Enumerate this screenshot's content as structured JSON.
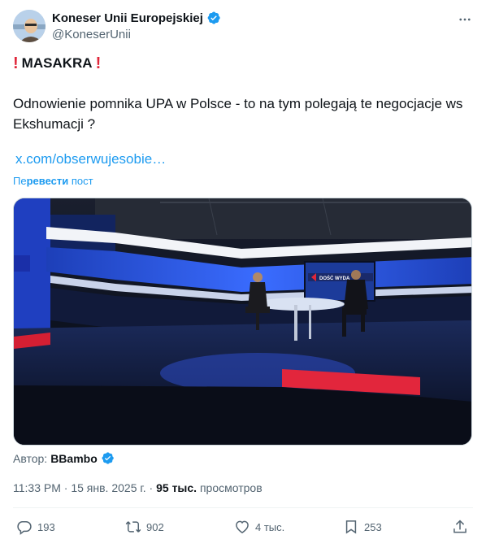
{
  "header": {
    "display_name": "Koneser Unii Europejskiej",
    "handle": "@KoneserUnii",
    "more_icon": "more-horizontal-icon",
    "verified_color": "#1d9bf0"
  },
  "post": {
    "headline": "MASAKRA",
    "body": "Odnowienie pomnika UPA w Polsce - to na tym polegają te negocjacje ws Ekshumacji ?",
    "link": "x.com/obserwujesobie…",
    "translate_prefix": "Пе",
    "translate_bold": "ревести",
    "translate_suffix": " пост"
  },
  "media": {
    "screen_text": "DOŚĆ WYDA"
  },
  "attribution": {
    "label": "Автор:",
    "author": "BBambo"
  },
  "meta": {
    "time": "11:33 PM",
    "separator": "·",
    "date": "15 янв. 2025 г.",
    "views_count": "95 тыс.",
    "views_label": "просмотров"
  },
  "actions": {
    "replies": "193",
    "reposts": "902",
    "likes": "4 тыс.",
    "bookmarks": "253"
  },
  "colors": {
    "accent": "#1d9bf0",
    "text": "#0f1419",
    "secondary": "#536471",
    "alert": "#e0263a"
  }
}
